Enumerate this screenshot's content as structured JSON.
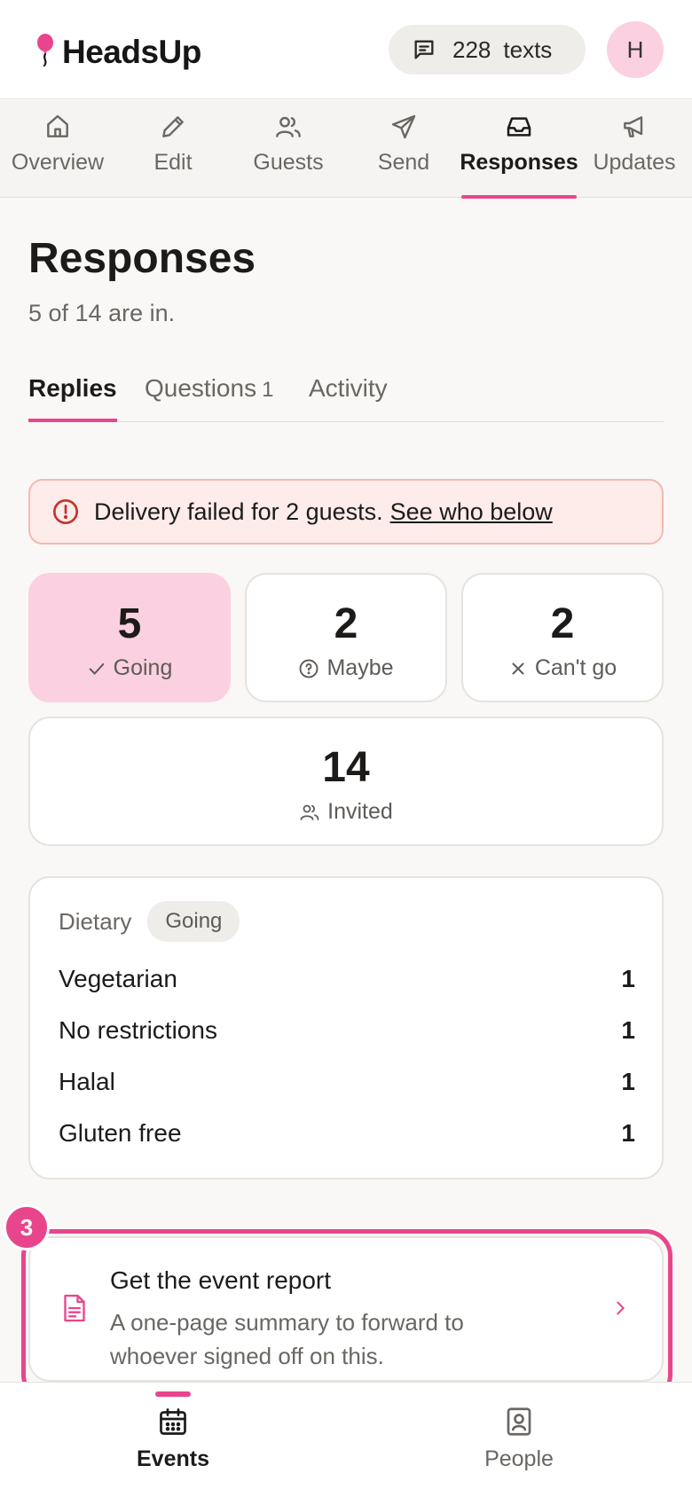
{
  "app": {
    "name": "HeadsUp",
    "accent": "#e8458d"
  },
  "header": {
    "texts_count": "228",
    "texts_word": "texts",
    "avatar_initial": "H"
  },
  "topnav": [
    {
      "label": "Overview",
      "icon": "home-icon"
    },
    {
      "label": "Edit",
      "icon": "pencil-icon"
    },
    {
      "label": "Guests",
      "icon": "users-icon"
    },
    {
      "label": "Send",
      "icon": "send-icon"
    },
    {
      "label": "Responses",
      "icon": "inbox-icon",
      "active": true
    },
    {
      "label": "Updates",
      "icon": "megaphone-icon"
    }
  ],
  "page": {
    "title": "Responses",
    "subtitle": "5 of 14 are in."
  },
  "subtabs": [
    {
      "label": "Replies",
      "active": true
    },
    {
      "label": "Questions",
      "badge": "1"
    },
    {
      "label": "Activity"
    }
  ],
  "alert": {
    "message": "Delivery failed for 2 guests.",
    "link": "See who below",
    "color": "#fdecea"
  },
  "stats": {
    "going": {
      "count": "5",
      "label": "Going"
    },
    "maybe": {
      "count": "2",
      "label": "Maybe"
    },
    "cant_go": {
      "count": "2",
      "label": "Can't go"
    },
    "invited": {
      "count": "14",
      "label": "Invited"
    }
  },
  "dietary": {
    "title": "Dietary",
    "filter": "Going",
    "rows": [
      {
        "label": "Vegetarian",
        "count": "1"
      },
      {
        "label": "No restrictions",
        "count": "1"
      },
      {
        "label": "Halal",
        "count": "1"
      },
      {
        "label": "Gluten free",
        "count": "1"
      }
    ]
  },
  "report": {
    "step": "3",
    "title": "Get the event report",
    "description": "A one-page summary to forward to whoever signed off on this."
  },
  "bottomnav": [
    {
      "label": "Events",
      "icon": "calendar-icon",
      "active": true
    },
    {
      "label": "People",
      "icon": "contacts-icon"
    }
  ]
}
